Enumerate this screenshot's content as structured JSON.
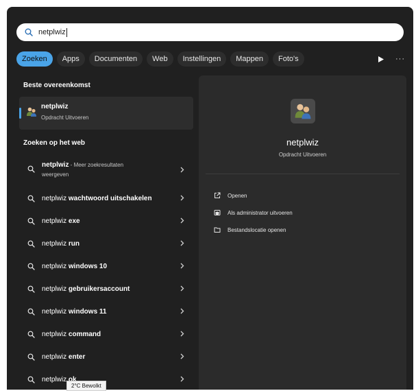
{
  "search": {
    "value": "netplwiz"
  },
  "filters": {
    "chips": [
      "Zoeken",
      "Apps",
      "Documenten",
      "Web",
      "Instellingen",
      "Mappen",
      "Foto's"
    ],
    "more": "···"
  },
  "best_match": {
    "title": "Beste overeenkomst",
    "name": "netplwiz",
    "subtitle": "Opdracht Uitvoeren"
  },
  "web": {
    "title": "Zoeken op het web",
    "items": [
      {
        "prefix": "netplwiz",
        "bold": "",
        "meta": " - Meer zoekresultaten",
        "line2": "weergeven"
      },
      {
        "prefix": "netplwiz ",
        "bold": "wachtwoord uitschakelen"
      },
      {
        "prefix": "netplwiz ",
        "bold": "exe"
      },
      {
        "prefix": "netplwiz ",
        "bold": "run"
      },
      {
        "prefix": "netplwiz ",
        "bold": "windows 10"
      },
      {
        "prefix": "netplwiz ",
        "bold": "gebruikersaccount"
      },
      {
        "prefix": "netplwiz ",
        "bold": "windows 11"
      },
      {
        "prefix": "netplwiz ",
        "bold": "command"
      },
      {
        "prefix": "netplwiz ",
        "bold": "enter"
      },
      {
        "prefix": "netplwiz ",
        "bold": "ok"
      }
    ]
  },
  "detail": {
    "name": "netplwiz",
    "subtitle": "Opdracht Uitvoeren",
    "actions": [
      "Openen",
      "Als administrator uitvoeren",
      "Bestandslocatie openen"
    ]
  },
  "tooltip": {
    "text": "2°C Bewolkt"
  },
  "colors": {
    "accent": "#4aa4e8",
    "panel": "#202020",
    "pane": "#2b2b2b"
  }
}
